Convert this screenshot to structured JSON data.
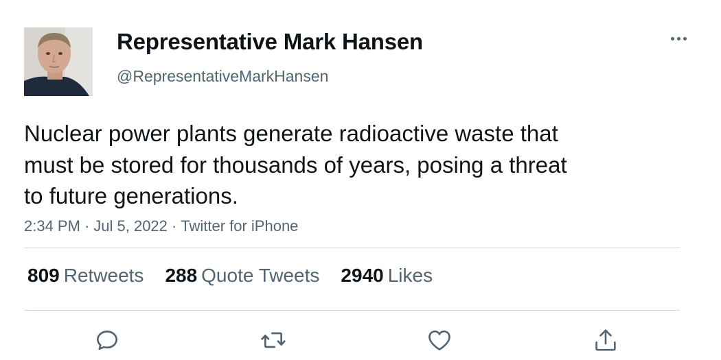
{
  "author": {
    "display_name": "Representative Mark Hansen",
    "handle": "@RepresentativeMarkHansen"
  },
  "tweet": {
    "text_lines": [
      "Nuclear power plants generate radioactive waste that",
      "must be stored for thousands of years, posing a threat",
      "to future generations."
    ],
    "time": "2:34 PM",
    "date": "Jul 5, 2022",
    "source": "Twitter for iPhone",
    "separator": "·"
  },
  "stats": [
    {
      "count": "809",
      "label": "Retweets"
    },
    {
      "count": "288",
      "label": "Quote Tweets"
    },
    {
      "count": "2940",
      "label": "Likes"
    }
  ],
  "actions": [
    {
      "icon": "reply-icon"
    },
    {
      "icon": "retweet-icon"
    },
    {
      "icon": "like-icon"
    },
    {
      "icon": "share-icon"
    }
  ],
  "colors": {
    "text_primary": "#0f1419",
    "text_secondary": "#536471",
    "divider": "#cfd9de"
  }
}
